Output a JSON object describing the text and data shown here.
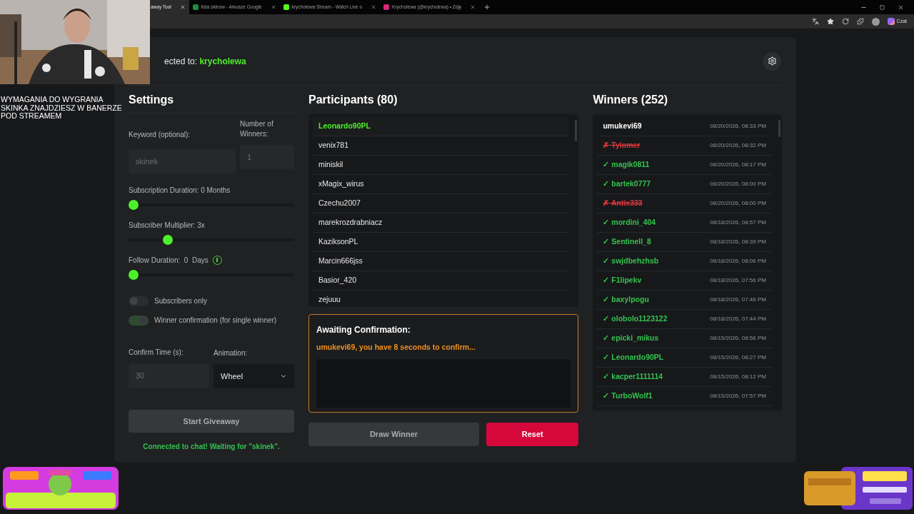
{
  "browser": {
    "tabs": [
      {
        "label": "away Tool",
        "selected": true
      },
      {
        "label": "lista skinow - Arkusze Google",
        "selected": false
      },
      {
        "label": "krycholewa Stream - Watch Live o",
        "selected": false
      },
      {
        "label": "Krycholewa (@krycholewa) • Zdję",
        "selected": false
      }
    ],
    "copilot_label": "Czat"
  },
  "stream_overlay": {
    "caption_lines": [
      "WYMAGANIA DO WYGRANIA",
      "SKINKA ZNAJDZIESZ W BANERZE",
      "POD STREAMEM"
    ]
  },
  "header": {
    "connected_label": "ected to:",
    "channel": "krycholewa"
  },
  "settings": {
    "title": "Settings",
    "keyword_label": "Keyword (optional):",
    "keyword_value": "skinek",
    "winners_label": "Number of Winners:",
    "winners_value": "1",
    "sliders": [
      {
        "label": "Subscription Duration: 0 Months",
        "level": 0
      },
      {
        "label": "Subscriber Multiplier: 3x",
        "level": 0.22
      },
      {
        "label": "Follow Duration:  0  Days",
        "level": 0,
        "info": true
      }
    ],
    "toggles": [
      {
        "label": "Subscribers only",
        "on": false
      },
      {
        "label": "Winner confirmation (for single winner)",
        "on": true
      }
    ],
    "confirm_label": "Confirm Time (s):",
    "confirm_value": "30",
    "animation_label": "Animation:",
    "animation_value": "Wheel",
    "start_button": "Start Giveaway",
    "status": "Connected to chat! Waiting for \"skinek\"."
  },
  "participants": {
    "title": "Participants (80)",
    "items": [
      {
        "name": "Leonardo90PL",
        "selected": true
      },
      {
        "name": "venix781",
        "selected": false
      },
      {
        "name": "miniskil",
        "selected": false
      },
      {
        "name": "xMagix_wirus",
        "selected": false
      },
      {
        "name": "Czechu2007",
        "selected": false
      },
      {
        "name": "marekrozdrabniacz",
        "selected": false
      },
      {
        "name": "KaziksonPL",
        "selected": false
      },
      {
        "name": "Marcin666jss",
        "selected": false
      },
      {
        "name": "Basior_420",
        "selected": false
      },
      {
        "name": "zejuuu",
        "selected": false
      }
    ]
  },
  "confirmation": {
    "title": "Awaiting Confirmation:",
    "message": "umukevi69, you have 8 seconds to confirm..."
  },
  "actions": {
    "draw": "Draw Winner",
    "reset": "Reset"
  },
  "winners": {
    "title": "Winners (252)",
    "items": [
      {
        "kind": "pending",
        "name": "umukevi69",
        "time": "08/20/2026, 08:33 PM"
      },
      {
        "kind": "rejected",
        "mark": "✗",
        "name": "Tylomer",
        "time": "08/20/2026, 08:32 PM"
      },
      {
        "kind": "confirmed",
        "mark": "✓",
        "name": "magik0811",
        "time": "08/20/2026, 08:17 PM"
      },
      {
        "kind": "confirmed",
        "mark": "✓",
        "name": "bartek0777",
        "time": "08/20/2026, 08:00 PM"
      },
      {
        "kind": "rejected",
        "mark": "✗",
        "name": "Antix333",
        "time": "08/20/2026, 08:00 PM"
      },
      {
        "kind": "confirmed",
        "mark": "✓",
        "name": "mordini_404",
        "time": "08/18/2026, 08:57 PM"
      },
      {
        "kind": "confirmed",
        "mark": "✓",
        "name": "Sentinell_8",
        "time": "08/18/2026, 08:39 PM"
      },
      {
        "kind": "confirmed",
        "mark": "✓",
        "name": "swjdbehzhsb",
        "time": "08/18/2026, 08:06 PM"
      },
      {
        "kind": "confirmed",
        "mark": "✓",
        "name": "F1lipekv",
        "time": "08/18/2026, 07:56 PM"
      },
      {
        "kind": "confirmed",
        "mark": "✓",
        "name": "baxylpogu",
        "time": "08/18/2026, 07:46 PM"
      },
      {
        "kind": "confirmed",
        "mark": "✓",
        "name": "olobolo1123122",
        "time": "08/18/2026, 07:44 PM"
      },
      {
        "kind": "confirmed",
        "mark": "✓",
        "name": "epicki_mikus",
        "time": "08/15/2026, 08:56 PM"
      },
      {
        "kind": "confirmed",
        "mark": "✓",
        "name": "Leonardo90PL",
        "time": "08/15/2026, 08:27 PM"
      },
      {
        "kind": "confirmed",
        "mark": "✓",
        "name": "kacper1111114",
        "time": "08/15/2026, 08:12 PM"
      },
      {
        "kind": "confirmed",
        "mark": "✓",
        "name": "TurboWolf1",
        "time": "08/15/2026, 07:57 PM"
      }
    ]
  }
}
